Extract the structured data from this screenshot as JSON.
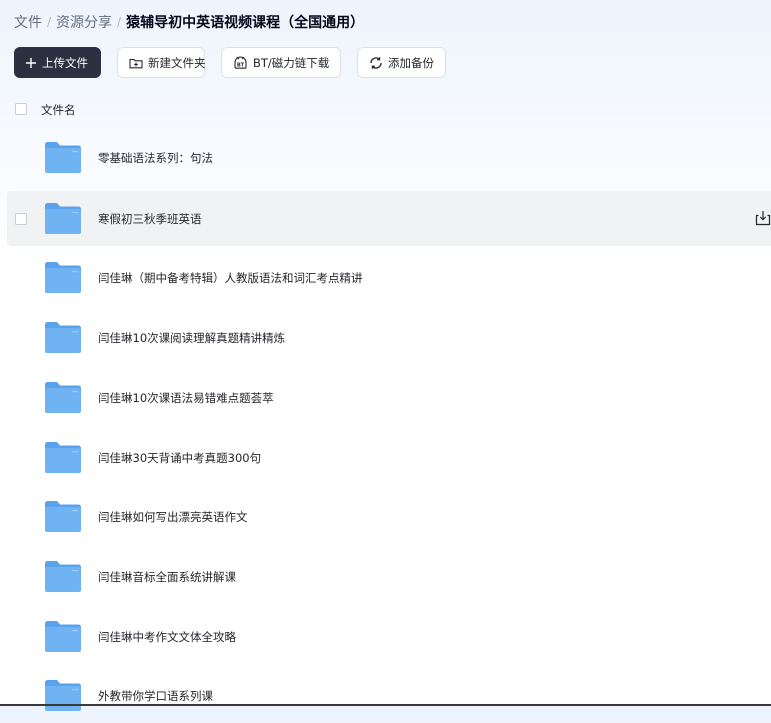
{
  "breadcrumb": {
    "items": [
      "文件",
      "资源分享"
    ],
    "separator": "/",
    "current": "猿辅导初中英语视频课程（全国通用）"
  },
  "toolbar": {
    "upload_label": "上传文件",
    "new_folder_label": "新建文件夹",
    "bt_label": "BT/磁力链下载",
    "backup_label": "添加备份"
  },
  "list_header": {
    "name_column": "文件名"
  },
  "files": [
    {
      "name": "零基础语法系列：句法",
      "type": "folder"
    },
    {
      "name": "寒假初三秋季班英语",
      "type": "folder",
      "hovered": true
    },
    {
      "name": "闫佳琳（期中备考特辑）人教版语法和词汇考点精讲",
      "type": "folder"
    },
    {
      "name": "闫佳琳10次课阅读理解真题精讲精炼",
      "type": "folder"
    },
    {
      "name": "闫佳琳10次课语法易错难点题荟萃",
      "type": "folder"
    },
    {
      "name": "闫佳琳30天背诵中考真题300句",
      "type": "folder"
    },
    {
      "name": "闫佳琳如何写出漂亮英语作文",
      "type": "folder"
    },
    {
      "name": "闫佳琳音标全面系统讲解课",
      "type": "folder"
    },
    {
      "name": "闫佳琳中考作文文体全攻略",
      "type": "folder"
    },
    {
      "name": "外教带你学口语系列课",
      "type": "folder"
    }
  ],
  "colors": {
    "primary_button": "#2b3140",
    "folder_body": "#6fb3f2",
    "folder_tab": "#5aa3ec",
    "row_hover": "#f1f2f4",
    "text": "#25262b"
  },
  "icons": {
    "upload": "plus-icon",
    "new_folder": "folder-plus-icon",
    "bt": "bt-icon",
    "backup": "sync-icon",
    "folder": "folder-icon",
    "download": "download-icon"
  }
}
